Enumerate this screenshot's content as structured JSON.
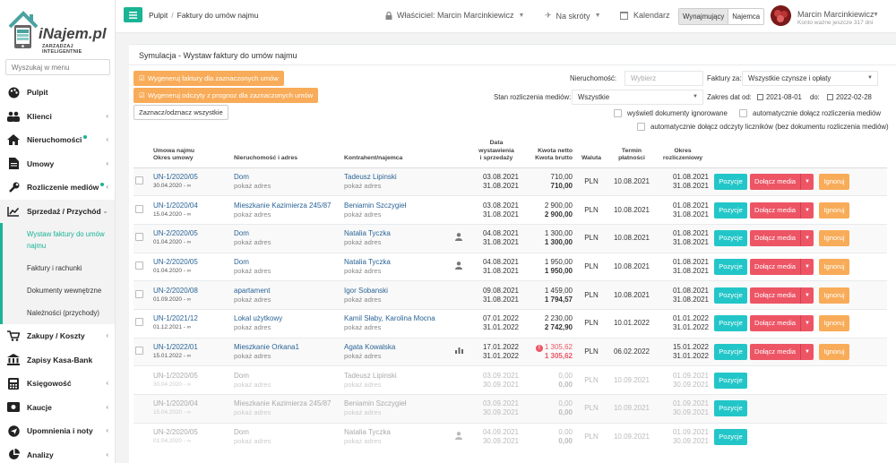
{
  "app": {
    "logo_text": "iNajem.pl",
    "logo_tagline": "ZARZĄDZAJ INTELIGENTNIE"
  },
  "sidebar": {
    "search_placeholder": "Wyszukaj w menu",
    "items": [
      {
        "label": "Pulpit",
        "icon": "palette-icon",
        "chevron": false,
        "dot": false
      },
      {
        "label": "Klienci",
        "icon": "users-icon",
        "chevron": true,
        "dot": false
      },
      {
        "label": "Nieruchomości",
        "icon": "home-icon",
        "chevron": true,
        "dot": true
      },
      {
        "label": "Umowy",
        "icon": "document-icon",
        "chevron": true,
        "dot": false
      },
      {
        "label": "Rozliczenie mediów",
        "icon": "wrench-icon",
        "chevron": true,
        "dot": true
      },
      {
        "label": "Sprzedaż / Przychód",
        "icon": "chart-line-icon",
        "chevron": true,
        "dot": false,
        "expanded": true
      }
    ],
    "subitems": [
      "Wystaw faktury do umów najmu",
      "Faktury i rachunki",
      "Dokumenty wewnętrzne",
      "Należności (przychody)"
    ],
    "items_after": [
      {
        "label": "Zakupy / Koszty",
        "icon": "cart-icon"
      },
      {
        "label": "Zapisy Kasa-Bank",
        "icon": "bank-icon"
      },
      {
        "label": "Księgowość",
        "icon": "calculator-icon"
      },
      {
        "label": "Kaucje",
        "icon": "money-icon"
      },
      {
        "label": "Upomnienia i noty",
        "icon": "send-icon"
      },
      {
        "label": "Analizy",
        "icon": "pie-chart-icon"
      }
    ]
  },
  "topbar": {
    "breadcrumb": [
      "Pulpit",
      "Faktury do umów najmu"
    ],
    "owner": "Właściciel: Marcin Marcinkiewicz",
    "shortcuts": "Na skróty",
    "calendar": "Kalendarz",
    "toggle_left": "Wynajmujący",
    "toggle_right": "Najemca",
    "user_name": "Marcin Marcinkiewicz",
    "user_account": "Konto ważne jeszcze 317 dni"
  },
  "panel": {
    "title": "Symulacja - Wystaw faktury do umów najmu",
    "btn_generate_invoices": "Wygeneruj faktury dla zaznaczonych umów",
    "btn_generate_readings": "Wygeneruj odczyty z prognoz dla zaznaczonych umów",
    "btn_select_all": "Zaznacz/odznacz wszystkie",
    "filters": {
      "property_label": "Nieruchomość:",
      "property_placeholder": "Wybierz",
      "invoice_for_label": "Faktury za:",
      "invoice_for_value": "Wszystkie czynsze i opłaty",
      "media_status_label": "Stan rozliczenia mediów:",
      "media_status_value": "Wszystkie",
      "date_range_label": "Zakres dat od:",
      "date_from": "2021-08-01",
      "date_to_label": "do:",
      "date_to": "2022-02-28",
      "opt_show_ignored": "wyświetl dokumenty ignorowane",
      "opt_auto_media": "automatycznie dołącz rozliczenia mediów",
      "opt_auto_readings": "automatycznie dołącz odczyty liczników (bez dokumentu rozliczenia mediów)"
    },
    "columns": {
      "contract": "Umowa najmu",
      "contract2": "Okres umowy",
      "property": "Nieruchomość i adres",
      "contractor": "Kontrahent/najemca",
      "dates": "Data",
      "dates2": "wystawienia",
      "dates3": "i sprzedaży",
      "amount": "Kwota netto",
      "amount2": "Kwota brutto",
      "currency": "Waluta",
      "due": "Termin",
      "due2": "płatności",
      "period": "Okres",
      "period2": "rozliczeniowy"
    },
    "row_buttons": {
      "positions": "Pozycje",
      "attach_media": "Dołącz media",
      "ignore": "Ignoruj"
    },
    "rows": [
      {
        "contract": "UN-1/2020/05",
        "period_c": "30.04.2020 - ∞",
        "property": "Dom",
        "address": "pokaż adres",
        "contractor": "Tadeusz Lipinski",
        "contractor_sub": "pokaż adres",
        "person": false,
        "chart": false,
        "date1": "03.08.2021",
        "date2": "31.08.2021",
        "net": "710,00",
        "gross": "710,00",
        "alert": false,
        "cur": "PLN",
        "due": "10.08.2021",
        "p1": "01.08.2021",
        "p2": "31.08.2021",
        "full": true,
        "dim": false
      },
      {
        "contract": "UN-1/2020/04",
        "period_c": "15.04.2020 - ∞",
        "property": "Mieszkanie Kazimierza 245/87",
        "address": "pokaż adres",
        "contractor": "Beniamin Szczygieł",
        "contractor_sub": "pokaż adres",
        "person": false,
        "chart": false,
        "date1": "03.08.2021",
        "date2": "31.08.2021",
        "net": "2 900,00",
        "gross": "2 900,00",
        "alert": false,
        "cur": "PLN",
        "due": "10.08.2021",
        "p1": "01.08.2021",
        "p2": "31.08.2021",
        "full": true,
        "dim": false
      },
      {
        "contract": "UN-2/2020/05",
        "period_c": "01.04.2020 - ∞",
        "property": "Dom",
        "address": "pokaż adres",
        "contractor": "Natalia Tyczka",
        "contractor_sub": "pokaż adres",
        "person": true,
        "chart": false,
        "date1": "04.08.2021",
        "date2": "31.08.2021",
        "net": "1 300,00",
        "gross": "1 300,00",
        "alert": false,
        "cur": "PLN",
        "due": "10.08.2021",
        "p1": "01.08.2021",
        "p2": "31.08.2021",
        "full": true,
        "dim": false
      },
      {
        "contract": "UN-2/2020/05",
        "period_c": "01.04.2020 - ∞",
        "property": "Dom",
        "address": "pokaż adres",
        "contractor": "Natalia Tyczka",
        "contractor_sub": "pokaż adres",
        "person": true,
        "chart": false,
        "date1": "04.08.2021",
        "date2": "31.08.2021",
        "net": "1 950,00",
        "gross": "1 950,00",
        "alert": false,
        "cur": "PLN",
        "due": "10.08.2021",
        "p1": "01.08.2021",
        "p2": "31.08.2021",
        "full": true,
        "dim": false
      },
      {
        "contract": "UN-2/2020/08",
        "period_c": "01.09.2020 - ∞",
        "property": "apartament",
        "address": "pokaż adres",
        "contractor": "Igor Sobanski",
        "contractor_sub": "pokaż adres",
        "person": false,
        "chart": false,
        "date1": "09.08.2021",
        "date2": "31.08.2021",
        "net": "1 459,00",
        "gross": "1 794,57",
        "alert": false,
        "cur": "PLN",
        "due": "10.08.2021",
        "p1": "01.08.2021",
        "p2": "31.08.2021",
        "full": true,
        "dim": false
      },
      {
        "contract": "UN-1/2021/12",
        "period_c": "01.12.2021 - ∞",
        "property": "Lokal użytkowy",
        "address": "pokaż adres",
        "contractor": "Kamil Słaby, Karolina Mocna",
        "contractor_sub": "pokaż adres",
        "person": false,
        "chart": false,
        "date1": "07.01.2022",
        "date2": "31.01.2022",
        "net": "2 230,00",
        "gross": "2 742,90",
        "alert": false,
        "cur": "PLN",
        "due": "10.01.2022",
        "p1": "01.01.2022",
        "p2": "31.01.2022",
        "full": true,
        "dim": false
      },
      {
        "contract": "UN-1/2022/01",
        "period_c": "15.01.2022 - ∞",
        "property": "Mieszkanie Orkana1",
        "address": "pokaż adres",
        "contractor": "Agata Kowalska",
        "contractor_sub": "pokaż adres",
        "person": false,
        "chart": true,
        "date1": "17.01.2022",
        "date2": "31.01.2022",
        "net": "1 305,62",
        "gross": "1 305,62",
        "alert": true,
        "cur": "PLN",
        "due": "06.02.2022",
        "p1": "15.01.2022",
        "p2": "31.01.2022",
        "full": true,
        "dim": false
      },
      {
        "contract": "UN-1/2020/05",
        "period_c": "30.04.2020 - ∞",
        "property": "Dom",
        "address": "pokaż adres",
        "contractor": "Tadeusz Lipinski",
        "contractor_sub": "pokaż adres",
        "person": false,
        "chart": false,
        "date1": "03.09.2021",
        "date2": "30.09.2021",
        "net": "0,00",
        "gross": "0,00",
        "alert": false,
        "cur": "PLN",
        "due": "10.09.2021",
        "p1": "01.09.2021",
        "p2": "30.09.2021",
        "full": false,
        "dim": true
      },
      {
        "contract": "UN-1/2020/04",
        "period_c": "15.04.2020 - ∞",
        "property": "Mieszkanie Kazimierza 245/87",
        "address": "pokaż adres",
        "contractor": "Beniamin Szczygieł",
        "contractor_sub": "pokaż adres",
        "person": false,
        "chart": false,
        "date1": "03.09.2021",
        "date2": "30.09.2021",
        "net": "0,00",
        "gross": "0,00",
        "alert": false,
        "cur": "PLN",
        "due": "10.09.2021",
        "p1": "01.09.2021",
        "p2": "30.09.2021",
        "full": false,
        "dim": true
      },
      {
        "contract": "UN-2/2020/05",
        "period_c": "01.04.2020 - ∞",
        "property": "Dom",
        "address": "pokaż adres",
        "contractor": "Natalia Tyczka",
        "contractor_sub": "pokaż adres",
        "person": true,
        "chart": false,
        "date1": "04.09.2021",
        "date2": "30.09.2021",
        "net": "0,00",
        "gross": "0,00",
        "alert": false,
        "cur": "PLN",
        "due": "10.09.2021",
        "p1": "01.09.2021",
        "p2": "30.09.2021",
        "full": false,
        "dim": true
      }
    ]
  }
}
